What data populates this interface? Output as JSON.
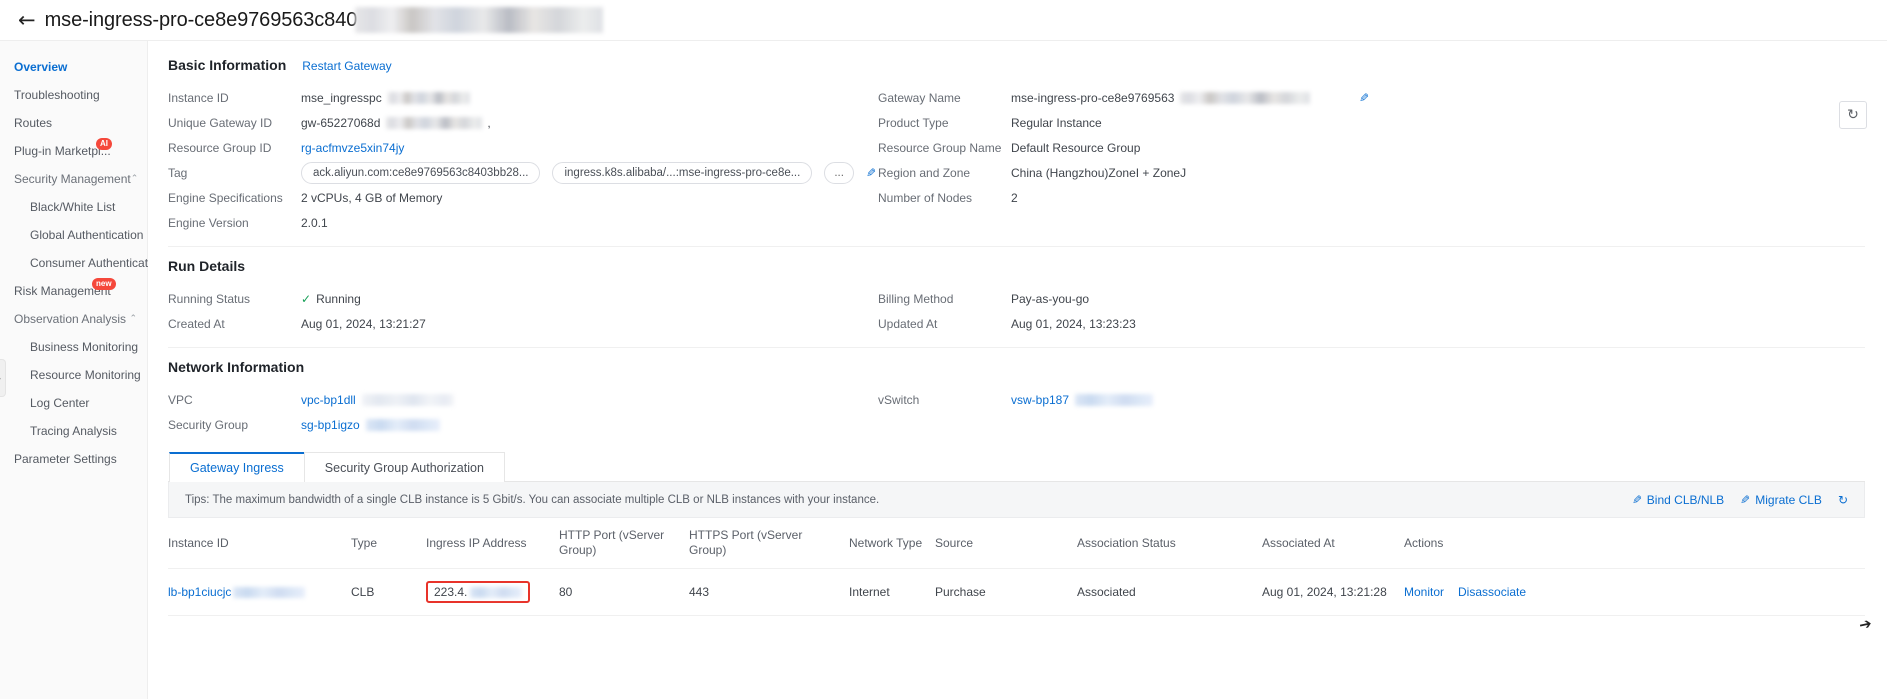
{
  "header": {
    "back_icon": "arrow-left-icon",
    "title": "mse-ingress-pro-ce8e9769563c840"
  },
  "sidebar": {
    "items": [
      {
        "label": "Overview",
        "active": true,
        "level": 0
      },
      {
        "label": "Troubleshooting",
        "active": false,
        "level": 0
      },
      {
        "label": "Routes",
        "active": false,
        "level": 0
      },
      {
        "label": "Plug-in Marketpl...",
        "active": false,
        "level": 0,
        "badge": "AI"
      },
      {
        "label": "Security Management",
        "active": false,
        "level": 0,
        "group": true,
        "chevron": "chevron-up-icon"
      },
      {
        "label": "Black/White List",
        "active": false,
        "level": 1
      },
      {
        "label": "Global Authentication",
        "active": false,
        "level": 1
      },
      {
        "label": "Consumer Authenticat",
        "active": false,
        "level": 1
      },
      {
        "label": "Risk Management",
        "active": false,
        "level": 0,
        "badge": "new"
      },
      {
        "label": "Observation Analysis",
        "active": false,
        "level": 0,
        "group": true,
        "chevron": "chevron-up-icon"
      },
      {
        "label": "Business Monitoring",
        "active": false,
        "level": 1
      },
      {
        "label": "Resource Monitoring",
        "active": false,
        "level": 1
      },
      {
        "label": "Log Center",
        "active": false,
        "level": 1
      },
      {
        "label": "Tracing Analysis",
        "active": false,
        "level": 1
      },
      {
        "label": "Parameter Settings",
        "active": false,
        "level": 0
      }
    ],
    "collapse_handle_icon": "chevron-right-icon"
  },
  "toolbar": {
    "refresh_icon": "refresh-icon"
  },
  "basic_information": {
    "title": "Basic Information",
    "restart_link": "Restart Gateway",
    "left": [
      {
        "key": "Instance ID",
        "value": "mse_ingresspc",
        "redacted": true,
        "redact_width": 82
      },
      {
        "key": "Unique Gateway ID",
        "value": "gw-65227068d",
        "redacted": true,
        "redact_width": 96,
        "suffix": ","
      },
      {
        "key": "Resource Group ID",
        "value": "rg-acfmvze5xin74jy",
        "link": true
      },
      {
        "key": "Tag",
        "value": "",
        "tags": [
          "ack.aliyun.com:ce8e9769563c8403bb28...",
          "ingress.k8s.alibaba/...:mse-ingress-pro-ce8e..."
        ],
        "tag_more": "...",
        "tag_edit_icon": "edit-icon"
      },
      {
        "key": "Engine Specifications",
        "value": "2 vCPUs, 4 GB of Memory"
      },
      {
        "key": "Engine Version",
        "value": "2.0.1"
      }
    ],
    "right": [
      {
        "key": "Gateway Name",
        "value": "mse-ingress-pro-ce8e9769563",
        "redacted": true,
        "redact_width": 130,
        "edit_icon": "edit-icon"
      },
      {
        "key": "Product Type",
        "value": "Regular Instance"
      },
      {
        "key": "Resource Group Name",
        "value": "Default Resource Group"
      },
      {
        "key": "Region and Zone",
        "value": "China (Hangzhou)ZoneI + ZoneJ"
      },
      {
        "key": "Number of Nodes",
        "value": "2"
      }
    ]
  },
  "run_details": {
    "title": "Run Details",
    "left": [
      {
        "key": "Running Status",
        "value": "Running",
        "status_icon": "check-icon"
      },
      {
        "key": "Created At",
        "value": "Aug 01, 2024, 13:21:27"
      }
    ],
    "right": [
      {
        "key": "Billing Method",
        "value": "Pay-as-you-go"
      },
      {
        "key": "Updated At",
        "value": "Aug 01, 2024, 13:23:23"
      }
    ]
  },
  "network_information": {
    "title": "Network Information",
    "left": [
      {
        "key": "VPC",
        "value": "vpc-bp1dll",
        "link": true,
        "redacted": true,
        "redact_width": 92,
        "redact_style": "light"
      },
      {
        "key": "Security Group",
        "value": "sg-bp1igzo",
        "link": true,
        "redacted": true,
        "redact_width": 74,
        "redact_style": "blue"
      }
    ],
    "right": [
      {
        "key": "vSwitch",
        "value": "vsw-bp187",
        "link": true,
        "redacted": true,
        "redact_width": 78,
        "redact_style": "blue"
      }
    ]
  },
  "tabs": [
    {
      "label": "Gateway Ingress",
      "active": true
    },
    {
      "label": "Security Group Authorization",
      "active": false
    }
  ],
  "tips": {
    "text": "Tips: The maximum bandwidth of a single CLB instance is 5 Gbit/s. You can associate multiple CLB or NLB instances with your instance.",
    "actions": [
      {
        "label": "Bind CLB/NLB",
        "icon": "edit-icon"
      },
      {
        "label": "Migrate CLB",
        "icon": "edit-icon"
      }
    ],
    "refresh_icon": "refresh-icon"
  },
  "table": {
    "columns": [
      "Instance ID",
      "Type",
      "Ingress IP Address",
      "HTTP Port (vServer Group)",
      "HTTPS Port (vServer Group)",
      "Network Type",
      "Source",
      "Association Status",
      "Associated At",
      "Actions"
    ],
    "rows": [
      {
        "instance_id": "lb-bp1ciucjc",
        "instance_id_redacted": true,
        "type": "CLB",
        "ingress_ip": "223.4.",
        "ingress_ip_redacted": true,
        "ingress_ip_highlighted": true,
        "http_port": "80",
        "https_port": "443",
        "network_type": "Internet",
        "source": "Purchase",
        "association_status": "Associated",
        "associated_at": "Aug 01, 2024, 13:21:28",
        "actions": [
          "Monitor",
          "Disassociate"
        ]
      }
    ]
  },
  "colors": {
    "accent": "#0a6ed1",
    "highlight_box": "#e8332a",
    "success": "#18a058",
    "badge_red": "#f5483b"
  },
  "cursor": {
    "icon": "mouse-cursor-icon"
  }
}
